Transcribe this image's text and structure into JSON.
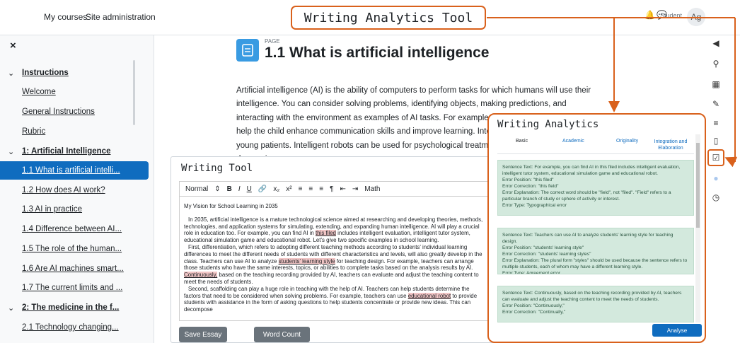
{
  "nav": {
    "my_courses": "My courses",
    "site_admin": "Site administration",
    "user": "Student",
    "avatar": "Ag"
  },
  "annotation_title": "Writing Analytics Tool",
  "colors": {
    "annotation": "#d9611c",
    "primary": "#0f6cbf",
    "card_bg": "#d3e9dd",
    "highlight": "#f2c6c6"
  },
  "sidebar": {
    "close": "×",
    "items": [
      {
        "label": "Instructions",
        "type": "section"
      },
      {
        "label": "Welcome",
        "type": "item"
      },
      {
        "label": "General Instructions",
        "type": "item"
      },
      {
        "label": "Rubric",
        "type": "item"
      },
      {
        "label": "1: Artificial Intelligence",
        "type": "section"
      },
      {
        "label": "1.1 What is artificial intelli...",
        "type": "active"
      },
      {
        "label": "1.2 How does AI work?",
        "type": "item"
      },
      {
        "label": "1.3 AI in practice",
        "type": "item"
      },
      {
        "label": "1.4 Difference between AI...",
        "type": "item"
      },
      {
        "label": "1.5 The role of the human...",
        "type": "item"
      },
      {
        "label": "1.6 Are AI machines smart...",
        "type": "item"
      },
      {
        "label": "1.7 The current limits and ...",
        "type": "item"
      },
      {
        "label": "2: The medicine in the f...",
        "type": "section"
      },
      {
        "label": "2.1 Technology changing...",
        "type": "item"
      }
    ]
  },
  "page": {
    "label": "PAGE",
    "title": "1.1 What is artificial intelligence",
    "body": "Artificial intelligence (AI) is the ability of computers to perform tasks for which humans will use their intelligence. You can consider solving problems, identifying objects, making predictions, and interacting with the environment as examples of AI tasks. For example, a robot can talk to a child to help the child enhance communication skills and improve learning. Intelligent robots can also be in young patients. Intelligent robots can be used for psychological treatment people who have depression."
  },
  "writing_tool": {
    "title": "Writing Tool",
    "toolbar": {
      "style": "Normal",
      "math": "Math"
    },
    "essay_title": "My Vision for School Learning in 2035",
    "para1_a": "In 2035, artificial intelligence is a mature technological science aimed at researching and developing theories, methods, technologies, and application systems for simulating, extending, and expanding human intelligence. AI will play a crucial role in education too. For example, you can find AI in ",
    "para1_hl1": "this filed",
    "para1_b": " includes intelligent evaluation, intelligent tutor system, educational simulation game and educational robot. Let's give two specific examples in school learning.",
    "para2_a": "First, differentiation, which refers to adopting different teaching methods according to students' individual learning differences to meet the different needs of students with different characteristics and levels, will also greatly develop in the class. Teachers can use AI to analyze ",
    "para2_hl1": "students' learning style",
    "para2_b": " for teaching design. For example, teachers can arrange those students who have the same interests, topics, or abilities to complete tasks based on the analysis results by AI. ",
    "para2_hl2": "Continuously,",
    "para2_c": " based on the teaching recording provided by AI, teachers can evaluate and adjust the teaching content to meet the needs of students.",
    "para3_a": "Second, scaffolding can play a huge role in teaching with the help of AI. Teachers can help students determine the factors that need to be considered when solving problems. For example, teachers can use ",
    "para3_hl1": "educational robot",
    "para3_b": " to provide students with assistance in the form of asking questions to help students concentrate or provide new ideas. This can decompose",
    "save_label": "Save Essay",
    "count_label": "Word Count"
  },
  "analytics": {
    "title": "Writing Analytics",
    "tabs": [
      "Basic",
      "Academic",
      "Originality",
      "Integration and Elaboration"
    ],
    "cards": [
      {
        "sentence": "Sentence Text: For example, you can find AI in this filed includes intelligent evaluation, intelligent tutor system, educational simulation game and educational robot.",
        "position": "Error Position: \"this filed\"",
        "correction": "Error Correction: \"this field\"",
        "explanation": "Error Explanation: The correct word should be \"field\", not \"filed\". \"Field\" refers to a particular branch of study or sphere of activity or interest.",
        "type": "Error Type: Typographical error"
      },
      {
        "sentence": "Sentence Text: Teachers can use AI to analyze students' learning style for teaching design.",
        "position": "Error Position: \"students' learning style\"",
        "correction": "Error Correction: \"students' learning styles\"",
        "explanation": "Error Explanation: The plural form \"styles\" should be used because the sentence refers to multiple students, each of whom may have a different learning style.",
        "type": "Error Type: Agreement error"
      },
      {
        "sentence": "Sentence Text: Continuously, based on the teaching recording provided by AI, teachers can evaluate and adjust the teaching content to meet the needs of students.",
        "position": "Error Position: \"Continuously,\"",
        "correction": "Error Correction: \"Continually,\"",
        "explanation": "",
        "type": ""
      }
    ],
    "analyse_label": "Analyse"
  }
}
